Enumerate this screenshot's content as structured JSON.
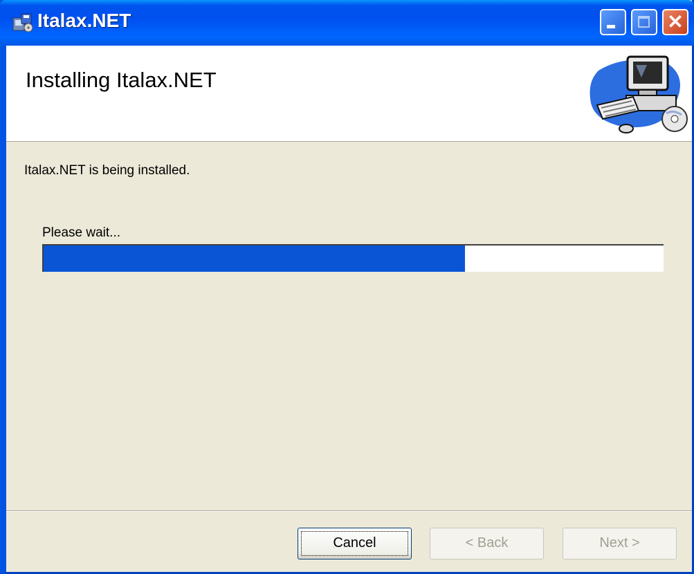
{
  "window": {
    "title": "Italax.NET",
    "controls": {
      "minimize": "minimize",
      "maximize": "maximize",
      "close": "✕"
    }
  },
  "header": {
    "title": "Installing Italax.NET"
  },
  "body": {
    "status": "Italax.NET is being installed.",
    "wait": "Please wait...",
    "progress_fraction": 0.68
  },
  "buttons": {
    "cancel": "Cancel",
    "back": "< Back",
    "next": "Next >"
  },
  "colors": {
    "title_bar": "#0054e3",
    "progress": "#0a55d6",
    "dialog_bg": "#ece9d8"
  }
}
